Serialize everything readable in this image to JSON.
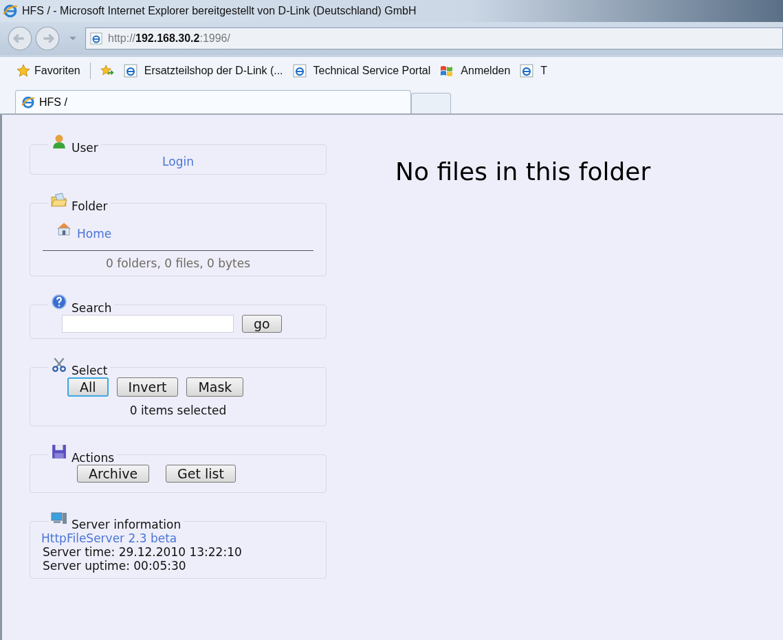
{
  "window": {
    "title": "HFS / - Microsoft Internet Explorer bereitgestellt von D-Link (Deutschland) GmbH"
  },
  "address_bar": {
    "url": "http://**192.168.30.2**:1996/"
  },
  "favorites_bar": {
    "label": "Favoriten",
    "links": [
      {
        "label": "Ersatzteilshop der D-Link (...",
        "kind": "page"
      },
      {
        "label": "Technical Service Portal",
        "kind": "page"
      },
      {
        "label": "Anmelden",
        "kind": "windows"
      },
      {
        "label": "T",
        "kind": "page"
      }
    ]
  },
  "tabs": [
    {
      "label": "HFS /",
      "selected": true
    }
  ],
  "panels": [
    {
      "kind": "user",
      "title": "User",
      "link": "Login"
    },
    {
      "kind": "folder",
      "title": "Folder",
      "link": "Home",
      "summary": "0 folders, 0 files, 0 bytes"
    },
    {
      "kind": "search",
      "title": "Search",
      "button": "go"
    },
    {
      "kind": "select",
      "title": "Select",
      "buttons": [
        {
          "label": "All",
          "focused": true
        },
        {
          "label": "Invert",
          "focused": false
        },
        {
          "label": "Mask",
          "focused": false
        }
      ],
      "summary": "0 items selected"
    },
    {
      "kind": "actions",
      "title": "Actions",
      "buttons": [
        {
          "label": "Archive",
          "focused": false
        },
        {
          "label": "Get list",
          "focused": false
        }
      ]
    },
    {
      "kind": "server",
      "title": "Server information",
      "link": "HttpFileServer 2.3 beta",
      "lines": [
        "Server time: 29.12.2010 13:22:10",
        "Server uptime: 00:05:30"
      ]
    }
  ],
  "message": "No files in this folder"
}
